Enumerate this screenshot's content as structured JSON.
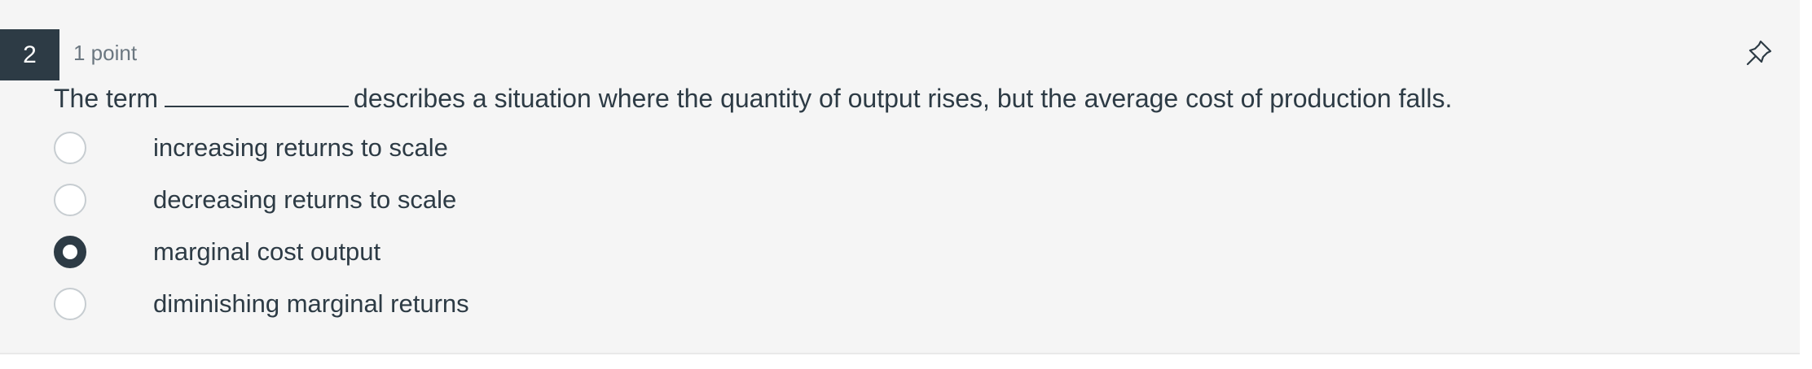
{
  "question": {
    "number": "2",
    "points": "1 point",
    "prompt_before": "The term",
    "prompt_after": "describes a situation where the quantity of output rises, but the average cost of production falls."
  },
  "options": [
    {
      "label": "increasing returns to scale",
      "selected": false
    },
    {
      "label": "decreasing returns to scale",
      "selected": false
    },
    {
      "label": "marginal cost output",
      "selected": true
    },
    {
      "label": "diminishing marginal returns",
      "selected": false
    }
  ],
  "icons": {
    "pin": "pin-icon"
  },
  "colors": {
    "badge": "#2d3b45",
    "text": "#2d3b45",
    "muted": "#6b7780",
    "radio_border": "#c7cdd1"
  }
}
